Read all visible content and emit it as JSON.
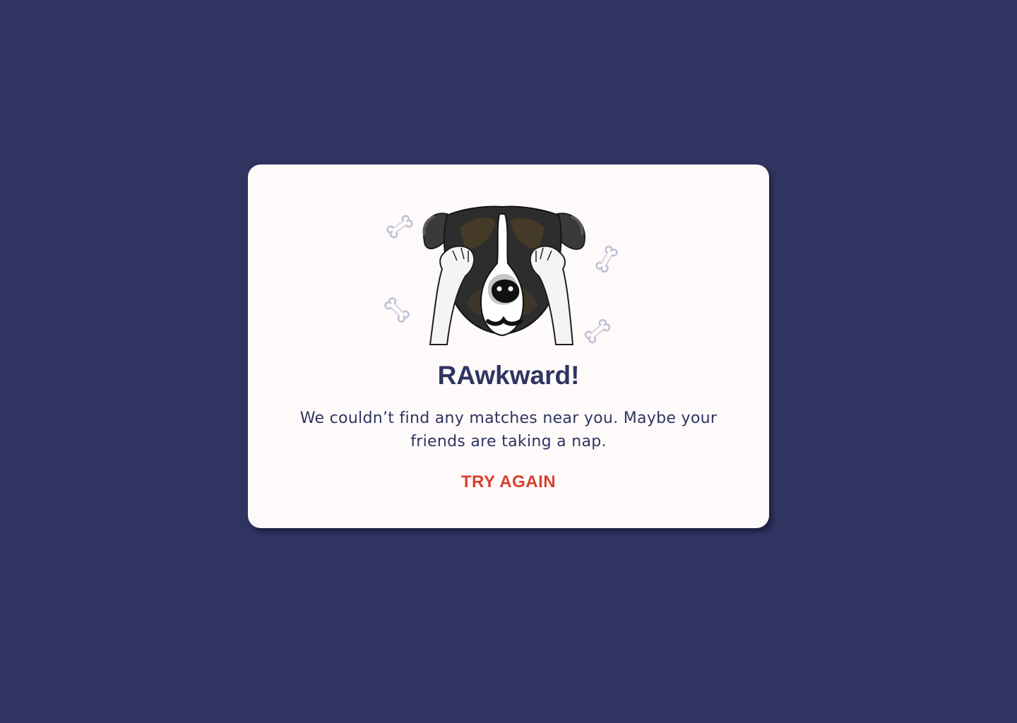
{
  "modal": {
    "title": "RAwkward!",
    "message": "We couldn’t find any matches near you. Maybe your friends are taking a nap.",
    "retry_label": "TRY AGAIN",
    "illustration": "dog-covering-eyes-icon"
  },
  "colors": {
    "background": "#2f3460",
    "card": "#fffafa",
    "title": "#2f3460",
    "accent": "#d9412f",
    "bone": "#bfbfd4"
  }
}
